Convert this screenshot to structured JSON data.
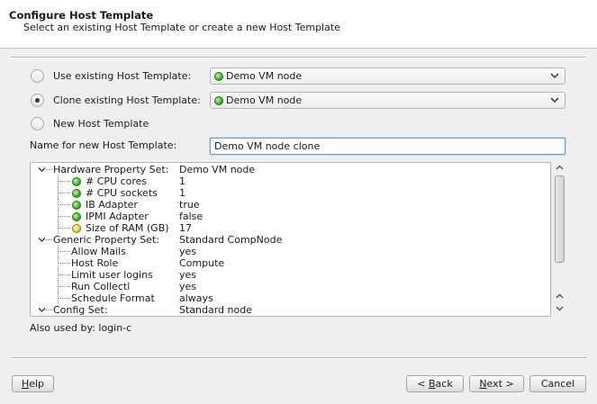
{
  "header": {
    "title": "Configure Host Template",
    "subtitle": "Select an existing Host Template or create a new Host Template"
  },
  "options": {
    "use_existing": {
      "label": "Use existing Host Template:",
      "selected": false,
      "combo_value": "Demo VM node",
      "combo_icon": "green-status-icon"
    },
    "clone_existing": {
      "label": "Clone existing Host Template:",
      "selected": true,
      "combo_value": "Demo VM node",
      "combo_icon": "green-status-icon"
    },
    "new_template": {
      "label": "New Host Template",
      "selected": false
    }
  },
  "name_field": {
    "label": "Name for new Host Template:",
    "value": "Demo VM node clone"
  },
  "tree": {
    "rows": [
      {
        "key": "Hardware Property Set:",
        "value": "Demo VM node",
        "level": 0,
        "expander": true
      },
      {
        "key": "# CPU cores",
        "value": "1",
        "level": 1,
        "status": "green"
      },
      {
        "key": "# CPU sockets",
        "value": "1",
        "level": 1,
        "status": "green"
      },
      {
        "key": "IB Adapter",
        "value": "true",
        "level": 1,
        "status": "green"
      },
      {
        "key": "IPMI Adapter",
        "value": "false",
        "level": 1,
        "status": "green"
      },
      {
        "key": "Size of RAM (GB)",
        "value": "17",
        "level": 1,
        "status": "yellow"
      },
      {
        "key": "Generic Property Set:",
        "value": "Standard CompNode",
        "level": 0,
        "expander": true
      },
      {
        "key": "Allow Mails",
        "value": "yes",
        "level": 1
      },
      {
        "key": "Host Role",
        "value": "Compute",
        "level": 1
      },
      {
        "key": "Limit user logins",
        "value": "yes",
        "level": 1
      },
      {
        "key": "Run Collectl",
        "value": "yes",
        "level": 1
      },
      {
        "key": "Schedule Format",
        "value": "always",
        "level": 1
      },
      {
        "key": "Config Set:",
        "value": "Standard node",
        "level": 0,
        "expander": true
      }
    ]
  },
  "also_used_by": "Also used by: login-c",
  "buttons": {
    "help": {
      "mnemonic": "H",
      "rest": "elp"
    },
    "back": {
      "prefix": "< ",
      "mnemonic": "B",
      "rest": "ack"
    },
    "next": {
      "mnemonic": "N",
      "rest": "ext >"
    },
    "cancel": "Cancel"
  },
  "colors": {
    "status_ok": "#3cb529",
    "status_warn": "#e4d33a",
    "focus_border": "#6aa0d4"
  }
}
